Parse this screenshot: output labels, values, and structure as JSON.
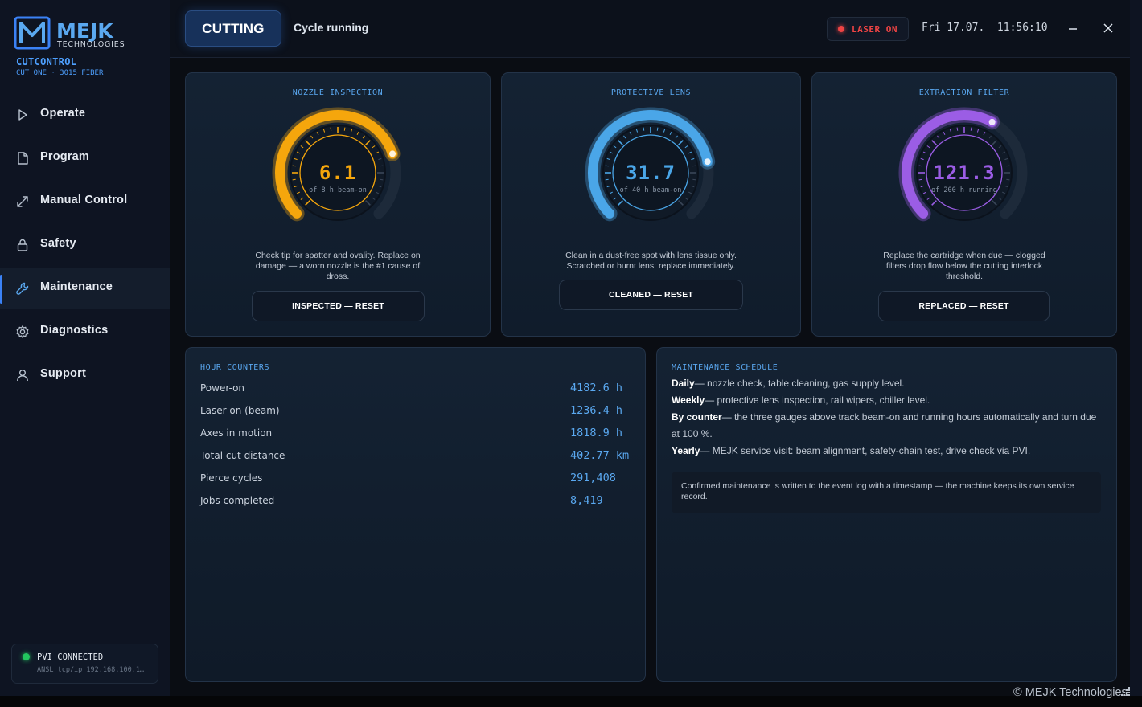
{
  "brand": {
    "name": "MEJK",
    "tagline": "TECHNOLOGIES",
    "app": "CUTCONTROL",
    "machine": "CUT ONE · 3015 FIBER"
  },
  "sidebar": {
    "items": [
      {
        "label": "Operate",
        "icon": "play-icon"
      },
      {
        "label": "Program",
        "icon": "document-icon"
      },
      {
        "label": "Manual Control",
        "icon": "move-arrows-icon"
      },
      {
        "label": "Safety",
        "icon": "lock-icon"
      },
      {
        "label": "Maintenance",
        "icon": "wrench-icon",
        "active": true
      },
      {
        "label": "Diagnostics",
        "icon": "gear-icon"
      },
      {
        "label": "Support",
        "icon": "user-icon"
      }
    ],
    "connection": {
      "title": "PVI CONNECTED",
      "detail": "ANSL tcp/ip 192.168.100.1…",
      "status_color": "#22c55e"
    }
  },
  "header": {
    "mode": "CUTTING",
    "status": "Cycle running",
    "laser": "LASER ON",
    "laser_color": "#ef4444",
    "datetime": "Fri 17.07.  11:56:10"
  },
  "gauges": [
    {
      "title": "NOZZLE INSPECTION",
      "value": "6.1",
      "limit": 8,
      "unit_text": "of 8 h beam-on",
      "color": "#f5a60c",
      "description": [
        "Check tip for spatter and ovality. Replace on",
        "damage — a worn nozzle is the #1 cause of",
        "dross."
      ],
      "button": "INSPECTED — RESET"
    },
    {
      "title": "PROTECTIVE LENS",
      "value": "31.7",
      "limit": 40,
      "unit_text": "of 40 h beam-on",
      "color": "#4aa6e8",
      "description": [
        "Clean in a dust-free spot with lens tissue only.",
        "Scratched or burnt lens: replace immediately."
      ],
      "button": "CLEANED — RESET"
    },
    {
      "title": "EXTRACTION FILTER",
      "value": "121.3",
      "limit": 200,
      "unit_text": "of 200 h running",
      "color": "#9b5de5",
      "description": [
        "Replace the cartridge when due — clogged",
        "filters drop flow below the cutting interlock",
        "threshold."
      ],
      "button": "REPLACED — RESET"
    }
  ],
  "hour_counters": {
    "title": "HOUR COUNTERS",
    "rows": [
      {
        "label": "Power-on",
        "value": "4182.6 h"
      },
      {
        "label": "Laser-on (beam)",
        "value": "1236.4 h"
      },
      {
        "label": "Axes in motion",
        "value": "1818.9 h"
      },
      {
        "label": "Total cut distance",
        "value": "402.77 km"
      },
      {
        "label": "Pierce cycles",
        "value": "291,408"
      },
      {
        "label": "Jobs completed",
        "value": "8,419"
      }
    ]
  },
  "schedule": {
    "title": "MAINTENANCE SCHEDULE",
    "lines": [
      {
        "term": "Daily",
        "text": "— nozzle check, table cleaning, gas supply level."
      },
      {
        "term": "Weekly",
        "text": "— protective lens inspection, rail wipers, chiller level."
      },
      {
        "term": "By counter",
        "text": "— the three gauges above track beam-on and running hours automatically and turn due at 100 %."
      },
      {
        "term": "Yearly",
        "text": "— MEJK service visit: beam alignment, safety-chain test, drive check via PVI."
      }
    ],
    "note": "Confirmed maintenance is written to the event log with a timestamp — the machine keeps its own service record."
  },
  "footer": {
    "copyright": "© MEJK Technologies"
  }
}
